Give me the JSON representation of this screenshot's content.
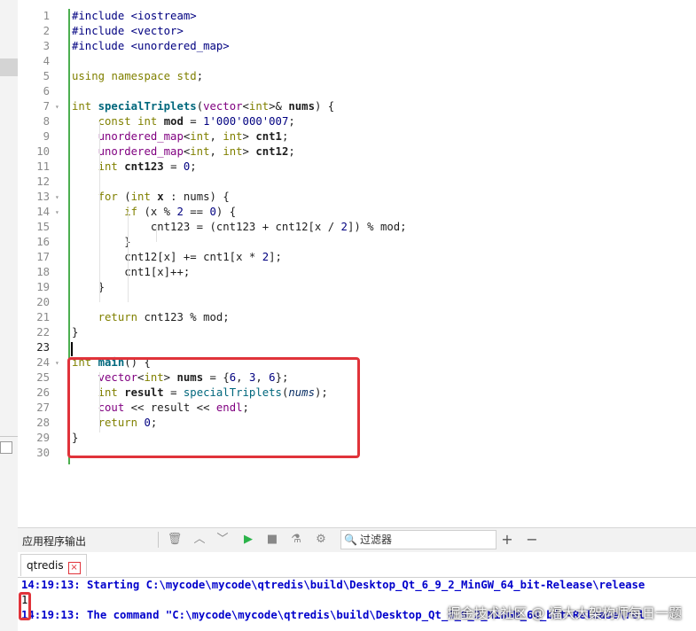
{
  "editor": {
    "lines": [
      {
        "n": "1",
        "fold": "",
        "html": "<span class=\"inc\">#include</span> <span class=\"inc\">&lt;iostream&gt;</span>"
      },
      {
        "n": "2",
        "fold": "",
        "html": "<span class=\"inc\">#include</span> <span class=\"inc\">&lt;vector&gt;</span>"
      },
      {
        "n": "3",
        "fold": "",
        "html": "<span class=\"inc\">#include</span> <span class=\"inc\">&lt;unordered_map&gt;</span>"
      },
      {
        "n": "4",
        "fold": "",
        "html": ""
      },
      {
        "n": "5",
        "fold": "",
        "html": "<span class=\"kw\">using</span> <span class=\"kw\">namespace</span> <span class=\"kw\">std</span>;"
      },
      {
        "n": "6",
        "fold": "",
        "html": ""
      },
      {
        "n": "7",
        "fold": "▾",
        "html": "<span class=\"kw\">int</span> <span class=\"fn\">specialTriplets</span>(<span class=\"tp\">vector</span>&lt;<span class=\"kw\">int</span>&gt;&amp; <span class=\"bold\">nums</span>) {"
      },
      {
        "n": "8",
        "fold": "",
        "html": "    <span class=\"kw\">const</span> <span class=\"kw\">int</span> <span class=\"bold\">mod</span> = <span class=\"num\">1'000'000'007</span>;"
      },
      {
        "n": "9",
        "fold": "",
        "html": "    <span class=\"tp\">unordered_map</span>&lt;<span class=\"kw\">int</span>, <span class=\"kw\">int</span>&gt; <span class=\"bold\">cnt1</span>;"
      },
      {
        "n": "10",
        "fold": "",
        "html": "    <span class=\"tp\">unordered_map</span>&lt;<span class=\"kw\">int</span>, <span class=\"kw\">int</span>&gt; <span class=\"bold\">cnt12</span>;"
      },
      {
        "n": "11",
        "fold": "",
        "html": "    <span class=\"kw\">int</span> <span class=\"bold\">cnt123</span> = <span class=\"num\">0</span>;"
      },
      {
        "n": "12",
        "fold": "",
        "html": ""
      },
      {
        "n": "13",
        "fold": "▾",
        "html": "    <span class=\"kw\">for</span> (<span class=\"kw\">int</span> <span class=\"bold\">x</span> : nums) {"
      },
      {
        "n": "14",
        "fold": "▾",
        "html": "        <span class=\"kw\">if</span> (x % <span class=\"num\">2</span> == <span class=\"num\">0</span>) {"
      },
      {
        "n": "15",
        "fold": "",
        "html": "            cnt123 = (cnt123 + cnt12[x / <span class=\"num\">2</span>]) % mod;"
      },
      {
        "n": "16",
        "fold": "",
        "html": "        }"
      },
      {
        "n": "17",
        "fold": "",
        "html": "        cnt12[x] += cnt1[x * <span class=\"num\">2</span>];"
      },
      {
        "n": "18",
        "fold": "",
        "html": "        cnt1[x]++;"
      },
      {
        "n": "19",
        "fold": "",
        "html": "    }"
      },
      {
        "n": "20",
        "fold": "",
        "html": ""
      },
      {
        "n": "21",
        "fold": "",
        "html": "    <span class=\"kw\">return</span> cnt123 % mod;"
      },
      {
        "n": "22",
        "fold": "",
        "html": "}"
      },
      {
        "n": "23",
        "fold": "",
        "html": ""
      },
      {
        "n": "24",
        "fold": "▾",
        "html": "<span class=\"kw\">int</span> <span class=\"fn\">main</span>() {"
      },
      {
        "n": "25",
        "fold": "",
        "html": "    <span class=\"tp\">vector</span>&lt;<span class=\"kw\">int</span>&gt; <span class=\"bold\">nums</span> = {<span class=\"num\">6</span>, <span class=\"num\">3</span>, <span class=\"num\">6</span>};"
      },
      {
        "n": "26",
        "fold": "",
        "html": "    <span class=\"kw\">int</span> <span class=\"bold\">result</span> = <span class=\"fn\" style=\"font-weight:normal\">specialTriplets</span>(<span class=\"it\">nums</span>);"
      },
      {
        "n": "27",
        "fold": "",
        "html": "    <span class=\"tp\">cout</span> &lt;&lt; result &lt;&lt; <span class=\"tp\">endl</span>;"
      },
      {
        "n": "28",
        "fold": "",
        "html": "    <span class=\"kw\">return</span> <span class=\"num\">0</span>;"
      },
      {
        "n": "29",
        "fold": "",
        "html": "}"
      },
      {
        "n": "30",
        "fold": "",
        "html": ""
      }
    ],
    "current_line": "23"
  },
  "panel": {
    "title": "应用程序输出",
    "filter_label": "过滤器",
    "tab_label": "qtredis",
    "tab_close": "×"
  },
  "output": {
    "line1": "14:19:13: Starting C:\\mycode\\mycode\\qtredis\\build\\Desktop_Qt_6_9_2_MinGW_64_bit-Release\\release",
    "line2": "1",
    "line3": "14:19:13: The command \"C:\\mycode\\mycode\\qtredis\\build\\Desktop_Qt_6_9_2_MinGW_64_bit-Release\\rel"
  },
  "watermark": "掘金技术社区 @ 福大大架构师每日一题",
  "icons": [
    "trash-icon",
    "up-icon",
    "down-icon",
    "run-icon",
    "stop-icon",
    "clean-icon",
    "gear-icon",
    "search-icon",
    "plus-icon",
    "minus-icon"
  ],
  "colors": {
    "highlight": "#e0333a",
    "change_bar": "#4caf50",
    "keyword": "#808000",
    "type": "#800080",
    "output_text": "#0000cc"
  }
}
